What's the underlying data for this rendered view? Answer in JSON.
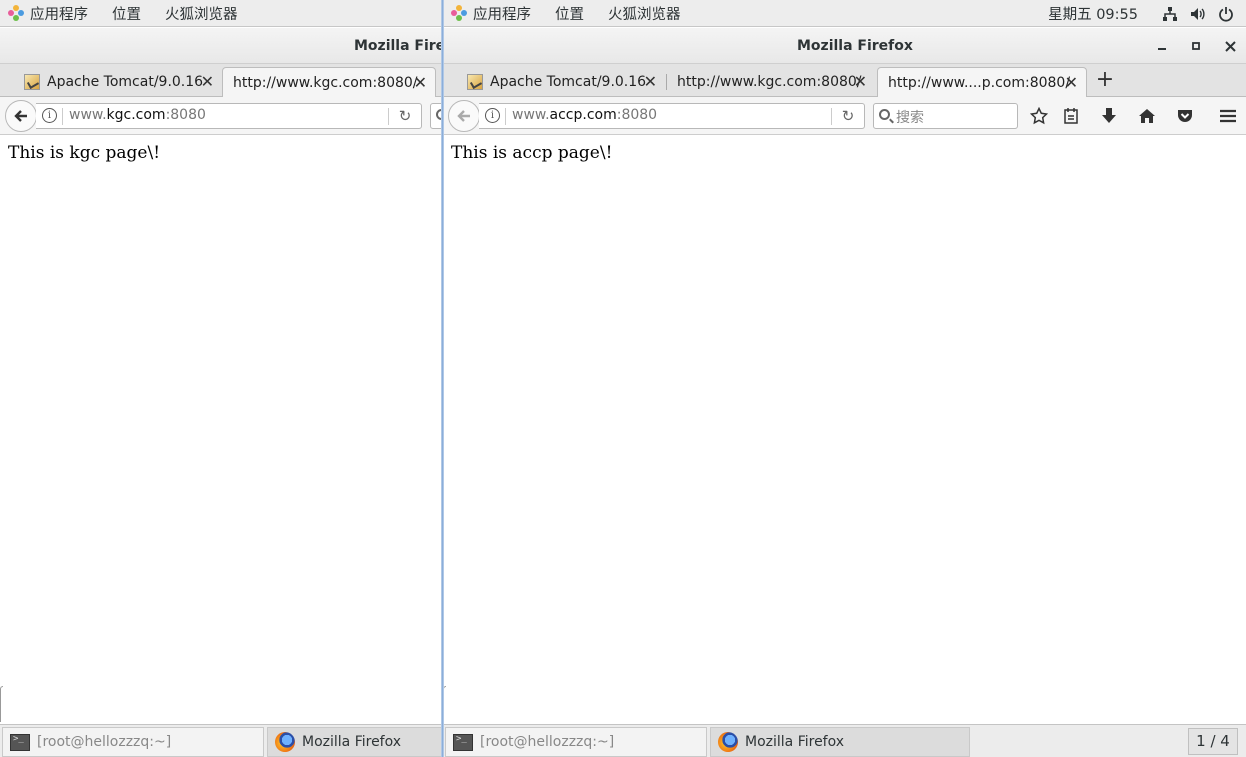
{
  "top_panel": {
    "applications": "应用程序",
    "places": "位置",
    "firefox_app": "火狐浏览器",
    "clock": "星期五 09:55"
  },
  "left_window": {
    "title": "Mozilla Firefo",
    "tabs": [
      {
        "title": "Apache Tomcat/9.0.16"
      },
      {
        "title": "http://www.kgc.com:8080/"
      }
    ],
    "url_host_prefix": "www.",
    "url_host_main": "kgc.com",
    "url_port": ":8080",
    "page_text": "This is kgc page\\!"
  },
  "right_window": {
    "title": "Mozilla Firefox",
    "tabs": [
      {
        "title": "Apache Tomcat/9.0.16"
      },
      {
        "title": "http://www.kgc.com:8080/"
      },
      {
        "title": "http://www....p.com:8080/"
      }
    ],
    "url_host_prefix": "www.",
    "url_host_main": "accp.com",
    "url_port": ":8080",
    "search_placeholder": "搜索",
    "page_text": "This is accp page\\!"
  },
  "taskbar_left": {
    "terminal": "[root@hellozzzq:~]",
    "firefox": "Mozilla Firefox"
  },
  "taskbar_right": {
    "terminal": "[root@hellozzzq:~]",
    "firefox": "Mozilla Firefox",
    "workspace": "1 / 4"
  }
}
